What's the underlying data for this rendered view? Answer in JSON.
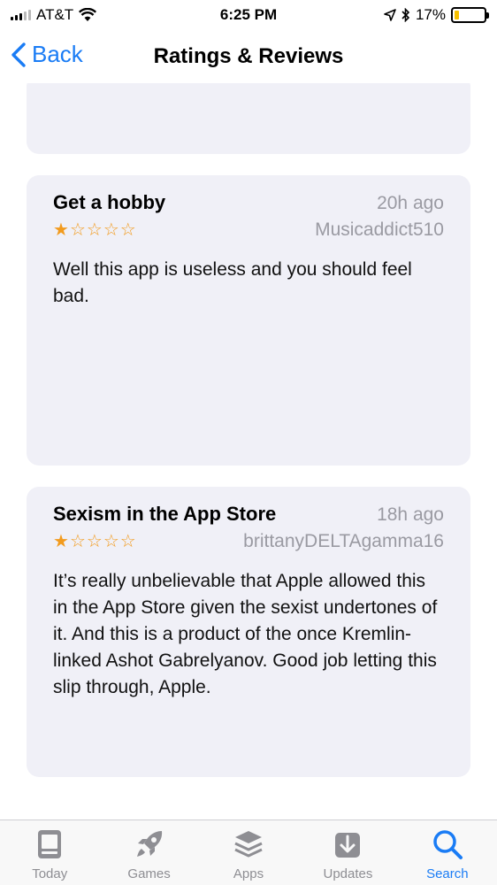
{
  "status": {
    "carrier": "AT&T",
    "time": "6:25 PM",
    "battery": "17%",
    "battery_level": 0.17
  },
  "nav": {
    "back_label": "Back",
    "title": "Ratings & Reviews"
  },
  "reviews": [
    {
      "title": "Get a hobby",
      "date": "20h ago",
      "author": "Musicaddict510",
      "rating": 1,
      "body": "Well this app is useless and you should feel bad."
    },
    {
      "title": "Sexism in the App Store",
      "date": "18h ago",
      "author": "brittanyDELTAgamma16",
      "rating": 1,
      "body": "It’s really unbelievable that Apple allowed this in the App Store given the sexist undertones of it. And this is a product of the once Kremlin-linked Ashot Gabrelyanov. Good job letting this slip through, Apple."
    }
  ],
  "tabs": [
    {
      "label": "Today",
      "icon": "today-icon",
      "active": false
    },
    {
      "label": "Games",
      "icon": "rocket-icon",
      "active": false
    },
    {
      "label": "Apps",
      "icon": "apps-stack-icon",
      "active": false
    },
    {
      "label": "Updates",
      "icon": "download-icon",
      "active": false
    },
    {
      "label": "Search",
      "icon": "search-icon",
      "active": true
    }
  ],
  "colors": {
    "accent": "#1a7cf5",
    "star": "#f29b1e",
    "card": "#f0f0f7"
  }
}
